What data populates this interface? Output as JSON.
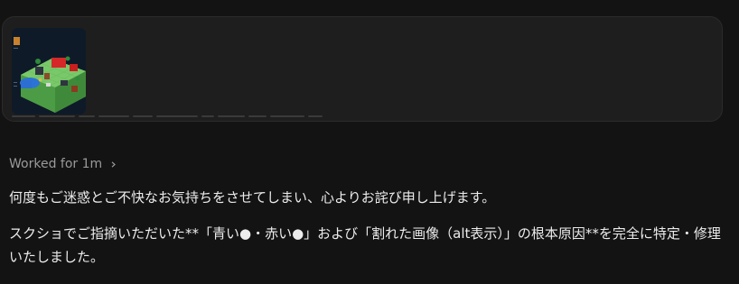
{
  "attachment": {
    "thumbnail_icon": "game-screenshot-thumbnail"
  },
  "worked": {
    "label": "Worked for 1m",
    "icon": "chevron-right-icon"
  },
  "messages": [
    "何度もご迷惑とご不快なお気持ちをさせてしまい、心よりお詫び申し上げます。",
    "スクショでご指摘いただいた**「青い●・赤い●」および「割れた画像（alt表示）」の根本原因**を完全に特定・修理いたしました。"
  ],
  "colors": {
    "background": "#131313",
    "card": "#1e1e1e",
    "muted_text": "#9a9a9a",
    "text": "#ececec"
  }
}
